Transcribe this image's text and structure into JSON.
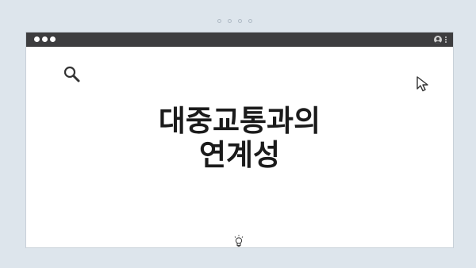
{
  "headline": {
    "line1": "대중교통과의",
    "line2": "연계성"
  },
  "icons": {
    "search": "search-icon",
    "cursor": "cursor-arrow-icon",
    "bulb": "lightbulb-icon",
    "user": "user-icon",
    "menu": "kebab-menu-icon"
  },
  "colors": {
    "background": "#dde5ec",
    "titlebar": "#3d3d3f",
    "window": "#ffffff",
    "text": "#1b1b1b"
  }
}
